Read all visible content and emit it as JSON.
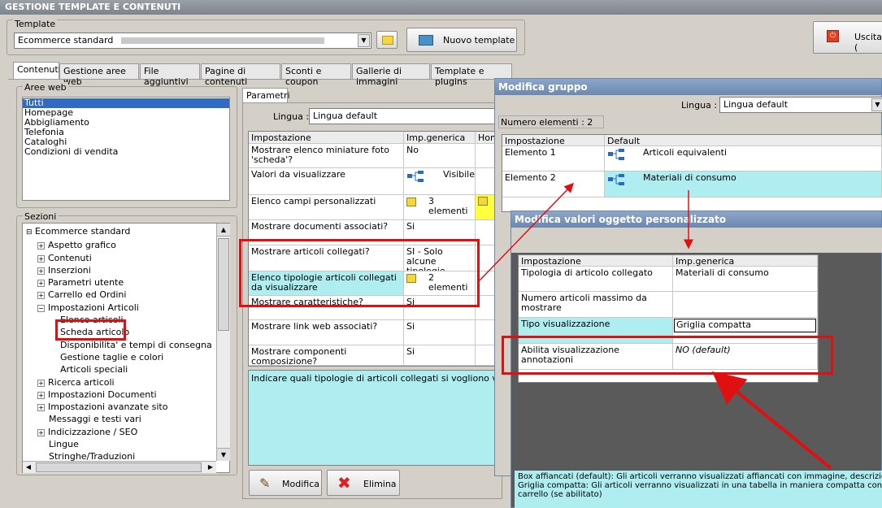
{
  "window": {
    "title": "GESTIONE TEMPLATE E CONTENUTI"
  },
  "template": {
    "label": "Template",
    "selected": "Ecommerce standard",
    "new_button": "Nuovo template",
    "exit_button": "Uscita ("
  },
  "tabs": [
    "Contenuti",
    "Gestione aree web",
    "File aggiuntivi",
    "Pagine di contenuti",
    "Sconti e coupon",
    "Gallerie di immagini",
    "Template e plugins"
  ],
  "aree_web": {
    "label": "Aree web",
    "items": [
      "Tutti",
      "Homepage",
      "Abbigliamento",
      "Telefonia",
      "Cataloghi",
      "Condizioni di vendita"
    ]
  },
  "sezioni": {
    "label": "Sezioni",
    "root": "Ecommerce standard",
    "items": [
      {
        "label": "Aspetto grafico",
        "expandable": true
      },
      {
        "label": "Contenuti",
        "expandable": true
      },
      {
        "label": "Inserzioni",
        "expandable": true
      },
      {
        "label": "Parametri utente",
        "expandable": true
      },
      {
        "label": "Carrello ed Ordini",
        "expandable": true
      },
      {
        "label": "Impostazioni Articoli",
        "expandable": true
      },
      {
        "label": "Elenco articoli",
        "expandable": false,
        "child": true
      },
      {
        "label": "Scheda articolo",
        "expandable": false,
        "child": true
      },
      {
        "label": "Disponibilita' e tempi di consegna",
        "expandable": false,
        "child": true
      },
      {
        "label": "Gestione taglie e colori",
        "expandable": false,
        "child": true
      },
      {
        "label": "Articoli speciali",
        "expandable": false,
        "child": true
      },
      {
        "label": "Ricerca articoli",
        "expandable": true
      },
      {
        "label": "Impostazioni Documenti",
        "expandable": true
      },
      {
        "label": "Impostazioni avanzate sito",
        "expandable": true
      },
      {
        "label": "Messaggi e testi vari",
        "expandable": false
      },
      {
        "label": "Indicizzazione / SEO",
        "expandable": true
      },
      {
        "label": "Lingue",
        "expandable": false
      },
      {
        "label": "Stringhe/Traduzioni",
        "expandable": false
      }
    ]
  },
  "parametri": {
    "tab": "Parametri",
    "lingua_label": "Lingua :",
    "lingua_value": "Lingua default",
    "headers": [
      "Impostazione",
      "Imp.generica",
      "Hom"
    ],
    "rows": [
      {
        "name": "Mostrare elenco miniature foto 'scheda'?",
        "value": "No"
      },
      {
        "name": "Valori da visualizzare",
        "value": "Visibile"
      },
      {
        "name": "Elenco campi personalizzati",
        "value": "3 elementi"
      },
      {
        "name": "Mostrare documenti associati?",
        "value": "Si"
      },
      {
        "name": "Mostrare articoli collegati?",
        "value": "SI - Solo alcune tipologie"
      },
      {
        "name": "Elenco tipologie articoli collegati da visualizzare",
        "value": "2 elementi"
      },
      {
        "name": "Mostrare caratteristiche?",
        "value": "Si"
      },
      {
        "name": "Mostrare link web associati?",
        "value": "Si"
      },
      {
        "name": "Mostrare componenti composizione?",
        "value": "Si"
      }
    ],
    "description": "Indicare quali tipologie di articoli collegati si vogliono visualizzare se",
    "modifica_button": "Modifica",
    "elimina_button": "Elimina"
  },
  "modifica_gruppo": {
    "title": "Modifica gruppo",
    "lingua_label": "Lingua :",
    "lingua_value": "Lingua default",
    "count": "Numero elementi : 2",
    "headers": [
      "Impostazione",
      "Default"
    ],
    "rows": [
      {
        "name": "Elemento 1",
        "value": "Articoli equivalenti"
      },
      {
        "name": "Elemento 2",
        "value": "Materiali di consumo"
      }
    ]
  },
  "modifica_valori": {
    "title": "Modifica valori oggetto personalizzato",
    "headers": [
      "Impostazione",
      "Imp.generica"
    ],
    "rows": [
      {
        "name": "Tipologia di articolo collegato",
        "value": "Materiali di consumo"
      },
      {
        "name": "Numero articoli massimo da mostrare",
        "value": ""
      },
      {
        "name": "Tipo visualizzazione",
        "value": "Griglia compatta"
      },
      {
        "name": "Abilita visualizzazione annotazioni",
        "value": "NO (default)"
      }
    ],
    "description_line1": "Box affiancati (default): Gli articoli verranno visualizzati affiancati con immagine, descrizione e prez",
    "description_line2": "Griglia compatta: Gli articoli verranno visualizzati in una tabella in maniera compatta con immagine,",
    "description_line3": "carrello (se abilitato)"
  },
  "colors": {
    "highlight": "#aeeef0",
    "selection": "#316ac5",
    "annotation_red": "#e01010"
  }
}
